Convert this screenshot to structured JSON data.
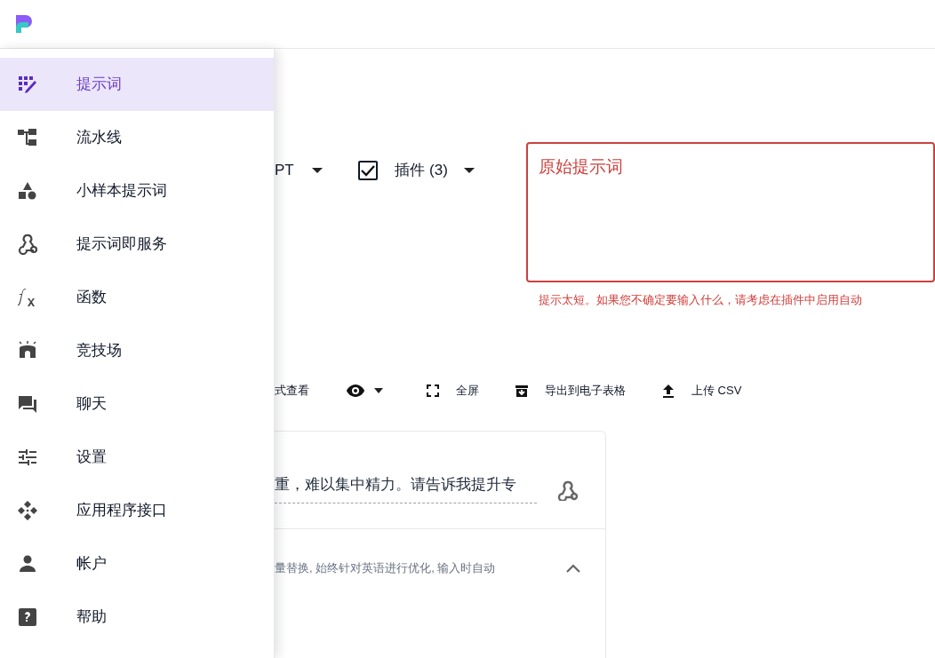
{
  "nav": [
    {
      "label": "提示词",
      "kind": "prompt",
      "selected": true
    },
    {
      "label": "流水线",
      "kind": "pipeline",
      "selected": false
    },
    {
      "label": "小样本提示词",
      "kind": "shapes",
      "selected": false
    },
    {
      "label": "提示词即服务",
      "kind": "webhook",
      "selected": false
    },
    {
      "label": "函数",
      "kind": "function",
      "selected": false
    },
    {
      "label": "竞技场",
      "kind": "arena",
      "selected": false
    },
    {
      "label": "聊天",
      "kind": "chat",
      "selected": false
    },
    {
      "label": "设置",
      "kind": "settings",
      "selected": false
    },
    {
      "label": "应用程序接口",
      "kind": "api",
      "selected": false
    },
    {
      "label": "帐户",
      "kind": "account",
      "selected": false
    },
    {
      "label": "帮助",
      "kind": "help",
      "selected": false
    }
  ],
  "options": {
    "model": "PT",
    "plugins": {
      "label": "插件 (3)",
      "checked": true
    }
  },
  "prompt_field": {
    "placeholder": "原始提示词",
    "helper_text": "提示太短。如果您不确定要输入什么，请考虑在插件中启用自动"
  },
  "toolbar": {
    "view_mode": "式查看",
    "actions": [
      {
        "label": "全屏",
        "kind": "fullscreen"
      },
      {
        "label": "导出到电子表格",
        "kind": "export"
      },
      {
        "label": "上传 CSV",
        "kind": "upload"
      }
    ]
  },
  "card": {
    "prompt_text": "重，难以集中精力。请告诉我提升专",
    "description": "量替换, 始终针对英语进行优化, 输入时自动",
    "expanded": true
  }
}
